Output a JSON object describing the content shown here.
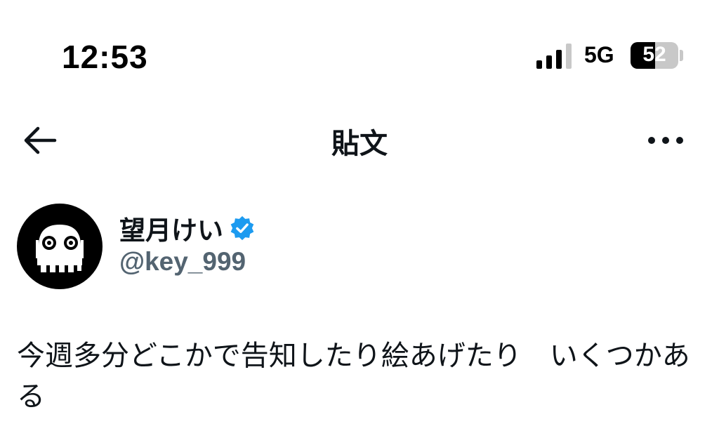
{
  "status_bar": {
    "time": "12:53",
    "network": "5G",
    "battery_level": 52,
    "battery_label": "52"
  },
  "nav": {
    "back_icon": "arrow-left-icon",
    "title": "貼文",
    "more_icon": "more-horizontal-icon"
  },
  "post": {
    "author": {
      "display_name": "望月けい",
      "handle": "@key_999",
      "verified": true,
      "avatar_icon": "skull-avatar"
    },
    "text": "今週多分どこかで告知したり絵あげたり　いくつかある"
  },
  "colors": {
    "text_primary": "#0f1419",
    "text_secondary": "#536471",
    "verified_badge": "#1d9bf0"
  }
}
